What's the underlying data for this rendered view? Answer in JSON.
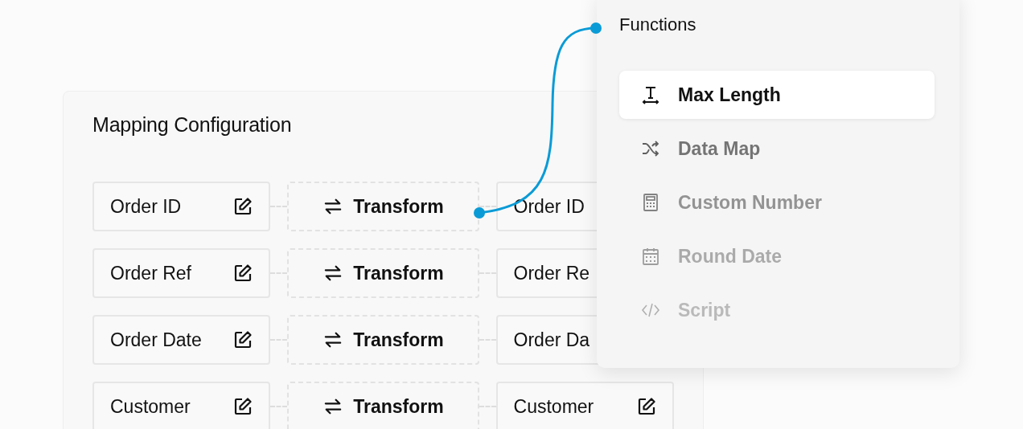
{
  "mapping": {
    "title": "Mapping Configuration",
    "rows": [
      {
        "source": "Order ID",
        "transform": "Transform",
        "target": "Order ID"
      },
      {
        "source": "Order Ref",
        "transform": "Transform",
        "target": "Order Re"
      },
      {
        "source": "Order Date",
        "transform": "Transform",
        "target": "Order Da"
      },
      {
        "source": "Customer",
        "transform": "Transform",
        "target": "Customer"
      }
    ]
  },
  "functions_menu": {
    "title": "Functions",
    "items": [
      {
        "label": "Max Length",
        "selected": true
      },
      {
        "label": "Data Map",
        "selected": false
      },
      {
        "label": "Custom Number",
        "selected": false
      },
      {
        "label": "Round Date",
        "selected": false
      },
      {
        "label": "Script",
        "selected": false
      }
    ]
  }
}
